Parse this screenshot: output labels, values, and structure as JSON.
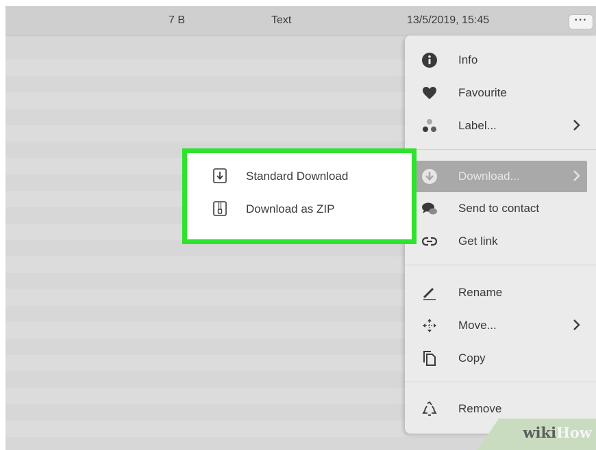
{
  "file_row": {
    "size": "7 B",
    "type": "Text",
    "modified": "13/5/2019, 15:45",
    "more_button": "···"
  },
  "context_menu": {
    "items": [
      {
        "label": "Info",
        "icon": "info-icon"
      },
      {
        "label": "Favourite",
        "icon": "heart-icon"
      },
      {
        "label": "Label...",
        "icon": "label-dots-icon",
        "has_submenu": true
      },
      {
        "label": "Download...",
        "icon": "download-circle-icon",
        "has_submenu": true,
        "active": true
      },
      {
        "label": "Send to contact",
        "icon": "chat-bubbles-icon"
      },
      {
        "label": "Get link",
        "icon": "link-icon"
      },
      {
        "label": "Rename",
        "icon": "pencil-icon"
      },
      {
        "label": "Move...",
        "icon": "move-arrows-icon",
        "has_submenu": true
      },
      {
        "label": "Copy",
        "icon": "copy-icon"
      },
      {
        "label": "Remove",
        "icon": "recycle-icon"
      }
    ]
  },
  "download_submenu": {
    "items": [
      {
        "label": "Standard Download",
        "icon": "download-file-icon"
      },
      {
        "label": "Download as ZIP",
        "icon": "zip-file-icon"
      }
    ],
    "highlight_color": "#2ee32e"
  },
  "watermark": {
    "part1": "wiki",
    "part2": "How"
  }
}
